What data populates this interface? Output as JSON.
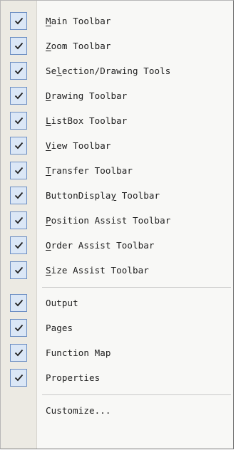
{
  "menu": {
    "group1": [
      {
        "mnemonic": "M",
        "rest": "ain Toolbar",
        "checked": true
      },
      {
        "mnemonic": "Z",
        "rest": "oom Toolbar",
        "checked": true
      },
      {
        "pre": "Se",
        "mnemonic": "l",
        "rest": "ection/Drawing Tools",
        "checked": true
      },
      {
        "mnemonic": "D",
        "rest": "rawing Toolbar",
        "checked": true
      },
      {
        "mnemonic": "L",
        "rest": "istBox Toolbar",
        "checked": true
      },
      {
        "mnemonic": "V",
        "rest": "iew Toolbar",
        "checked": true
      },
      {
        "mnemonic": "T",
        "rest": "ransfer Toolbar",
        "checked": true
      },
      {
        "pre": "ButtonDispla",
        "mnemonic": "y",
        "rest": " Toolbar",
        "checked": true
      },
      {
        "mnemonic": "P",
        "rest": "osition Assist Toolbar",
        "checked": true
      },
      {
        "mnemonic": "O",
        "rest": "rder Assist Toolbar",
        "checked": true
      },
      {
        "mnemonic": "S",
        "rest": "ize Assist Toolbar",
        "checked": true
      }
    ],
    "group2": [
      {
        "label": "Output",
        "checked": true
      },
      {
        "label": "Pages",
        "checked": true
      },
      {
        "label": "Function Map",
        "checked": true
      },
      {
        "label": "Properties",
        "checked": true
      }
    ],
    "group3": [
      {
        "label": "Customize...",
        "checked": false
      }
    ]
  },
  "colors": {
    "menu_background": "#f8f8f6",
    "gutter": "#eceae3",
    "check_fill": "#dbe7f6",
    "check_border": "#6c8ec2",
    "text": "#202020"
  },
  "icons": {
    "check": "checkmark-icon"
  }
}
